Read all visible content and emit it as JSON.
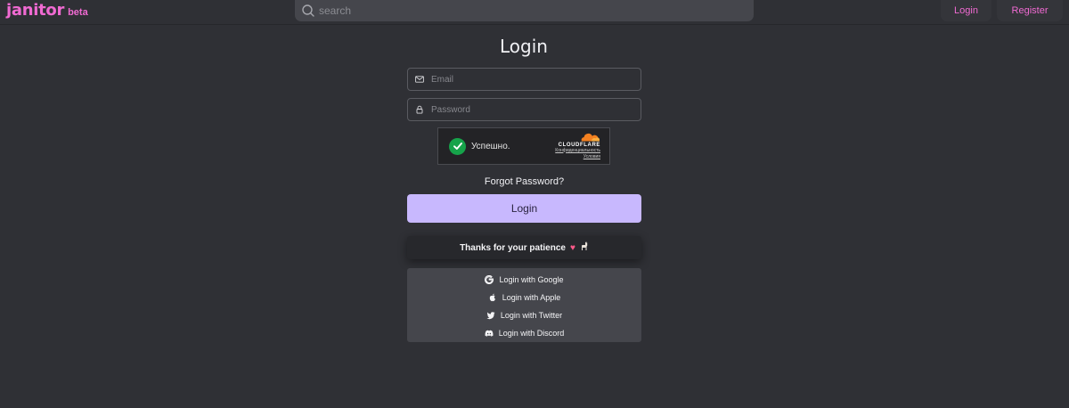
{
  "header": {
    "brand": "janitor",
    "brand_badge": "beta",
    "search_placeholder": "search",
    "nav_login": "Login",
    "nav_register": "Register"
  },
  "form": {
    "title": "Login",
    "email_placeholder": "Email",
    "password_placeholder": "Password",
    "captcha": {
      "status": "Успешно.",
      "brand": "CLOUDFLARE",
      "privacy_link": "Конфиденциальность",
      "terms_link": "Условия"
    },
    "forgot_password": "Forgot Password?",
    "submit_label": "Login",
    "notice": "Thanks for your patience",
    "oauth": [
      {
        "label": "Login with Google",
        "icon": "google-icon"
      },
      {
        "label": "Login with Apple",
        "icon": "apple-icon"
      },
      {
        "label": "Login with Twitter",
        "icon": "twitter-icon"
      },
      {
        "label": "Login with Discord",
        "icon": "discord-icon"
      }
    ]
  },
  "colors": {
    "background": "#2f3035",
    "brand_pink": "#f06ad2",
    "primary_button": "#c8b8fe",
    "captcha_success": "#16a34a"
  }
}
